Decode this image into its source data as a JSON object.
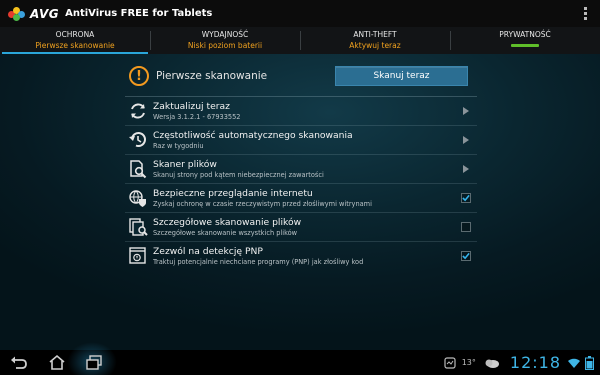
{
  "app": {
    "brand": "AVG",
    "title": "AntiVirus FREE for Tablets"
  },
  "tabs": [
    {
      "title": "OCHRONA",
      "subtitle": "Pierwsze skanowanie",
      "active": true
    },
    {
      "title": "WYDAJNOŚĆ",
      "subtitle": "Niski poziom baterii",
      "active": false
    },
    {
      "title": "ANTI-THEFT",
      "subtitle": "Aktywuj teraz",
      "active": false
    },
    {
      "title": "PRYWATNOŚĆ",
      "subtitle": "",
      "active": false
    }
  ],
  "first_scan": {
    "label": "Pierwsze skanowanie",
    "button": "Skanuj teraz"
  },
  "items": [
    {
      "title": "Zaktualizuj teraz",
      "subtitle": "Wersja 3.1.2.1 - 67933552",
      "control": "chevron"
    },
    {
      "title": "Częstotliwość automatycznego skanowania",
      "subtitle": "Raz w tygodniu",
      "control": "chevron"
    },
    {
      "title": "Skaner plików",
      "subtitle": "Skanuj strony pod kątem niebezpiecznej zawartości",
      "control": "chevron"
    },
    {
      "title": "Bezpieczne przeglądanie internetu",
      "subtitle": "Zyskaj ochronę w czasie rzeczywistym przed złośliwymi witrynami",
      "control": "checkbox",
      "checked": true
    },
    {
      "title": "Szczegółowe skanowanie plików",
      "subtitle": "Szczegółowe skanowanie wszystkich plików",
      "control": "checkbox",
      "checked": false
    },
    {
      "title": "Zezwól na detekcję PNP",
      "subtitle": "Traktuj potencjalnie niechciane programy (PNP) jak złośliwy kod",
      "control": "checkbox",
      "checked": true
    }
  ],
  "statusbar": {
    "temperature": "13°",
    "time": "12:18"
  },
  "colors": {
    "accent": "#2aa6d9",
    "warning": "#f39a1f",
    "tab_subtitle": "#f1a21f",
    "button": "#2b6e92",
    "clock": "#3fb5e6",
    "privacy_indicator": "#5fbf2a"
  },
  "icons": [
    "avg-logo-icon",
    "overflow-menu-icon",
    "warning-icon",
    "update-icon",
    "schedule-icon",
    "file-scanner-icon",
    "web-shield-icon",
    "deep-scan-icon",
    "pnp-detection-icon",
    "back-icon",
    "home-icon",
    "recent-apps-icon",
    "weather-icon",
    "wifi-icon",
    "battery-icon"
  ]
}
